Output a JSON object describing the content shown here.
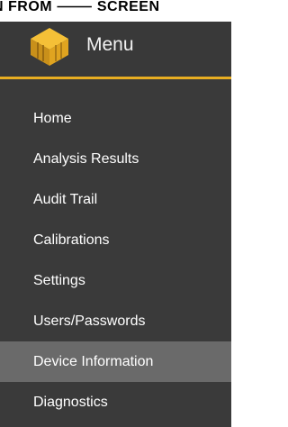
{
  "banner": {
    "text": "N FROM ⸻ SCREEN"
  },
  "menu": {
    "logo_icon": "hexagon-cube-logo",
    "title": "Menu",
    "accent_color": "#e8ae22",
    "items": [
      {
        "label": "Home",
        "active": false
      },
      {
        "label": "Analysis Results",
        "active": false
      },
      {
        "label": "Audit Trail",
        "active": false
      },
      {
        "label": "Calibrations",
        "active": false
      },
      {
        "label": "Settings",
        "active": false
      },
      {
        "label": "Users/Passwords",
        "active": false
      },
      {
        "label": "Device Information",
        "active": true
      },
      {
        "label": "Diagnostics",
        "active": false
      }
    ]
  }
}
